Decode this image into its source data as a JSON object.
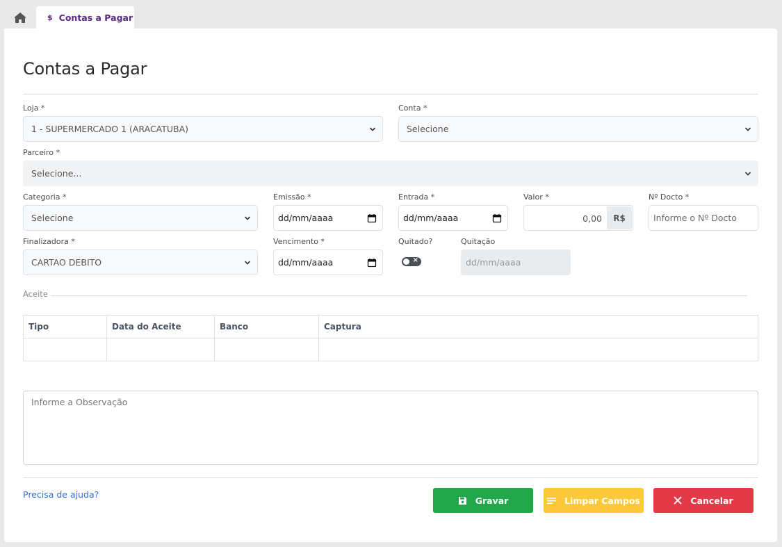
{
  "tabs": {
    "home_icon": "home-icon",
    "active_tab_icon": "$",
    "active_tab_label": "Contas a Pagar"
  },
  "page": {
    "title": "Contas a Pagar"
  },
  "form": {
    "loja": {
      "label": "Loja *",
      "value": "1 - SUPERMERCADO 1 (ARACATUBA)"
    },
    "conta": {
      "label": "Conta *",
      "value": "Selecione"
    },
    "parceiro": {
      "label": "Parceiro *",
      "value": "Selecione..."
    },
    "categoria": {
      "label": "Categoria *",
      "value": "Selecione"
    },
    "emissao": {
      "label": "Emissão *",
      "value": "dd/mm/aaaa"
    },
    "entrada": {
      "label": "Entrada *",
      "value": "dd/mm/aaaa"
    },
    "valor": {
      "label": "Valor *",
      "value": "0,00",
      "currency": "R$"
    },
    "n_docto": {
      "label": "Nº Docto *",
      "placeholder": "Informe o Nº Docto"
    },
    "finalizadora": {
      "label": "Finalizadora *",
      "value": "CARTAO DEBITO"
    },
    "vencimento": {
      "label": "Vencimento *",
      "value": "dd/mm/aaaa"
    },
    "quitado": {
      "label": "Quitado?",
      "checked": false
    },
    "quitacao": {
      "label": "Quitação",
      "value": "dd/mm/aaaa"
    }
  },
  "aceite": {
    "legend": "Aceite",
    "columns": [
      "Tipo",
      "Data do Aceite",
      "Banco",
      "Captura"
    ]
  },
  "observacao": {
    "placeholder": "Informe a Observação"
  },
  "footer": {
    "help_link": "Precisa de ajuda?",
    "save_label": "Gravar",
    "clear_label": "Limpar Campos",
    "cancel_label": "Cancelar"
  },
  "colors": {
    "accent_tab": "#5b2a86",
    "save": "#22a64a",
    "clear": "#fcc93a",
    "cancel": "#e23b47",
    "link": "#2f6fde"
  }
}
